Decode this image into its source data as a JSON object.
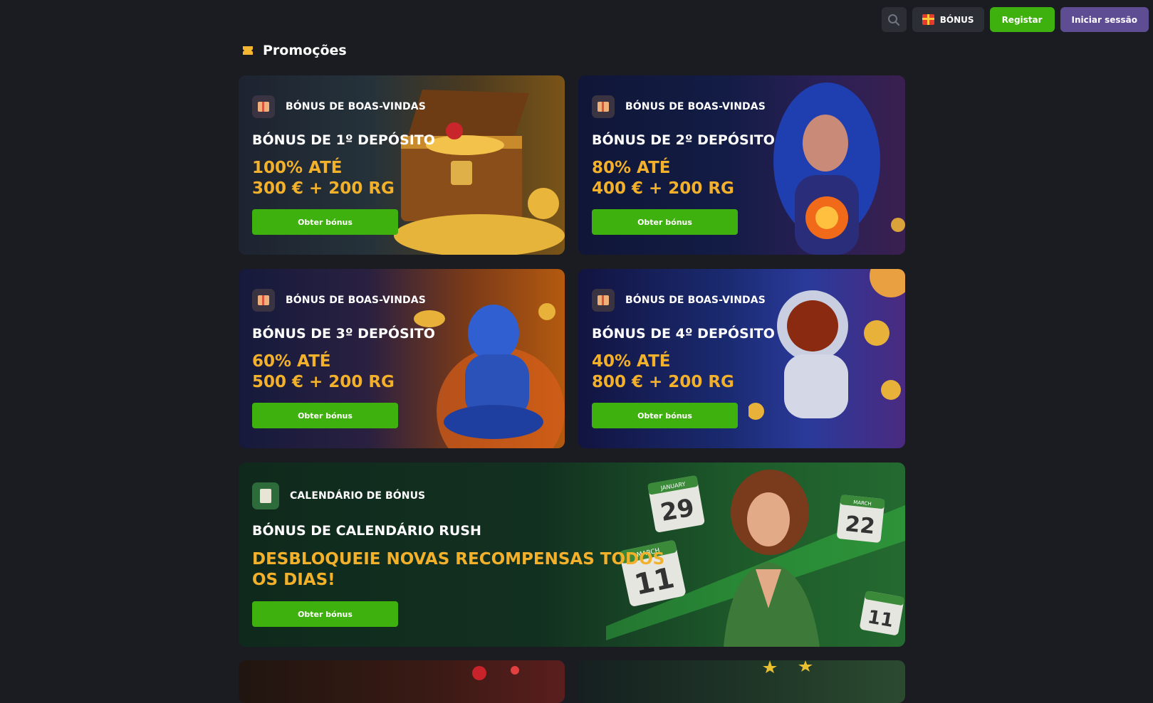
{
  "header": {
    "search_icon": "search-icon",
    "bonus_label": "BÓNUS",
    "register_label": "Registar",
    "login_label": "Iniciar sessão"
  },
  "page": {
    "title": "Promoções"
  },
  "promos": [
    {
      "tag": "BÓNUS DE BOAS-VINDAS",
      "title": "BÓNUS DE 1º DEPÓSITO",
      "amount_line1": "100% ATÉ",
      "amount_line2": "300 € + 200 RG",
      "cta": "Obter bónus"
    },
    {
      "tag": "BÓNUS DE BOAS-VINDAS",
      "title": "BÓNUS DE 2º DEPÓSITO",
      "amount_line1": "80% ATÉ",
      "amount_line2": "400 € + 200 RG",
      "cta": "Obter bónus"
    },
    {
      "tag": "BÓNUS DE BOAS-VINDAS",
      "title": "BÓNUS DE 3º DEPÓSITO",
      "amount_line1": "60% ATÉ",
      "amount_line2": "500 € + 200 RG",
      "cta": "Obter bónus"
    },
    {
      "tag": "BÓNUS DE BOAS-VINDAS",
      "title": "BÓNUS DE 4º DEPÓSITO",
      "amount_line1": "40% ATÉ",
      "amount_line2": "800 € + 200 RG",
      "cta": "Obter bónus"
    }
  ],
  "calendar": {
    "tag": "CALENDÁRIO DE BÓNUS",
    "title": "BÓNUS DE CALENDÁRIO RUSH",
    "amount_line1": "DESBLOQUEIE NOVAS RECOMPENSAS TODOS",
    "amount_line2": "OS DIAS!",
    "cta": "Obter bónus",
    "dates": [
      {
        "month": "JANUARY",
        "day": "29"
      },
      {
        "month": "MARCH",
        "day": "22"
      },
      {
        "month": "MARCH",
        "day": "11"
      },
      {
        "month": "",
        "day": "11"
      }
    ]
  },
  "colors": {
    "accent_green": "#3fb10f",
    "accent_gold": "#f3b12b",
    "login_purple": "#5f4d94",
    "background": "#1b1c21"
  }
}
